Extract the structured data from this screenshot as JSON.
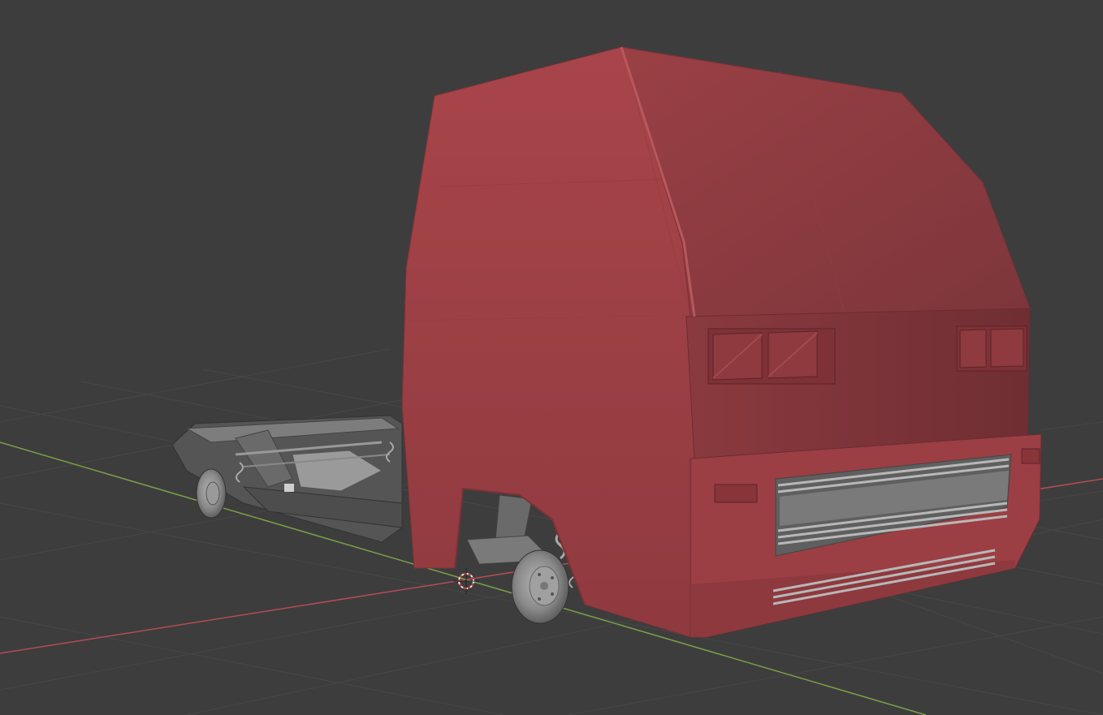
{
  "viewport": {
    "mode": "solid-shading",
    "colors": {
      "background": "#3d3d3d",
      "grid_line": "#474747",
      "x_axis": "#b34c55",
      "y_axis": "#7ba047",
      "body_red": "#a8464b",
      "body_red_dark": "#8c3a3f",
      "chassis_metal": "#7a7a7a"
    },
    "objects": [
      {
        "name": "truck-cab-body",
        "icon": "mesh-icon"
      },
      {
        "name": "chassis-frame",
        "icon": "mesh-icon"
      },
      {
        "name": "front-wheel-hub",
        "icon": "mesh-icon"
      },
      {
        "name": "rear-wheel-hub",
        "icon": "mesh-icon"
      }
    ],
    "cursor": {
      "icon": "3d-cursor-icon"
    }
  }
}
